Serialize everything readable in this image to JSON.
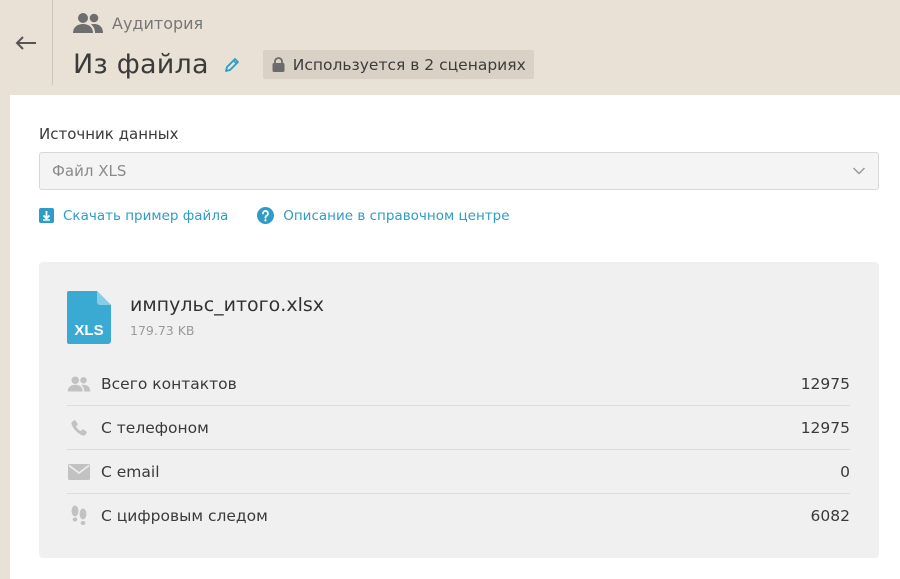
{
  "header": {
    "breadcrumb": "Аудитория",
    "title": "Из файла",
    "usage_badge": "Используется в 2 сценариях"
  },
  "source": {
    "label": "Источник данных",
    "selected": "Файл XLS"
  },
  "links": {
    "download_example": "Скачать пример файла",
    "help_center": "Описание в справочном центре"
  },
  "file": {
    "icon_label": "XLS",
    "name": "импульс_итого.xlsx",
    "size": "179.73 KB"
  },
  "stats": [
    {
      "icon": "contacts-icon",
      "label": "Всего контактов",
      "value": "12975"
    },
    {
      "icon": "phone-icon",
      "label": "С телефоном",
      "value": "12975"
    },
    {
      "icon": "email-icon",
      "label": "С email",
      "value": "0"
    },
    {
      "icon": "footprints-icon",
      "label": "С цифровым следом",
      "value": "6082"
    }
  ],
  "colors": {
    "header_bg": "#e9e1d6",
    "accent": "#2e9cc5",
    "xls_file": "#3aaad3"
  }
}
